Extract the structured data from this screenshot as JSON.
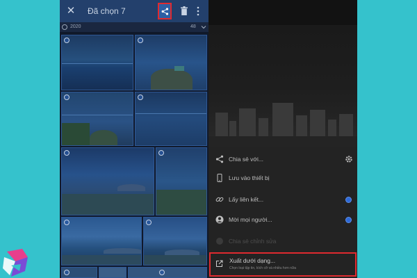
{
  "header": {
    "title": "Đã chọn 7",
    "close_icon": "close-icon",
    "share_icon": "share-icon",
    "trash_icon": "trash-icon",
    "more_icon": "more-vertical-icon"
  },
  "section": {
    "year": "2020",
    "count": "48"
  },
  "share_menu": {
    "items": [
      {
        "label": "Chia sẻ với...",
        "icon": "share-icon",
        "trailing": "gear-icon",
        "enabled": true
      },
      {
        "label": "Lưu vào thiết bị",
        "icon": "phone-icon",
        "trailing": "",
        "enabled": true
      },
      {
        "label": "Lấy liên kết...",
        "icon": "link-icon",
        "trailing": "info-dot",
        "enabled": true
      },
      {
        "label": "Mời mọi người...",
        "icon": "invite-person-icon",
        "trailing": "info-dot",
        "enabled": true
      },
      {
        "label": "Chia sẻ chỉnh sửa",
        "icon": "share-edit-icon",
        "trailing": "",
        "enabled": false
      }
    ],
    "export": {
      "label": "Xuất dưới dạng...",
      "sublabel": "Chọn loại tập tin, kích cỡ và nhiều hơn nữa",
      "icon": "export-icon"
    }
  },
  "colors": {
    "highlight": "#e02a2f",
    "accent": "#2f6ad8",
    "background": "#35c2cc"
  }
}
